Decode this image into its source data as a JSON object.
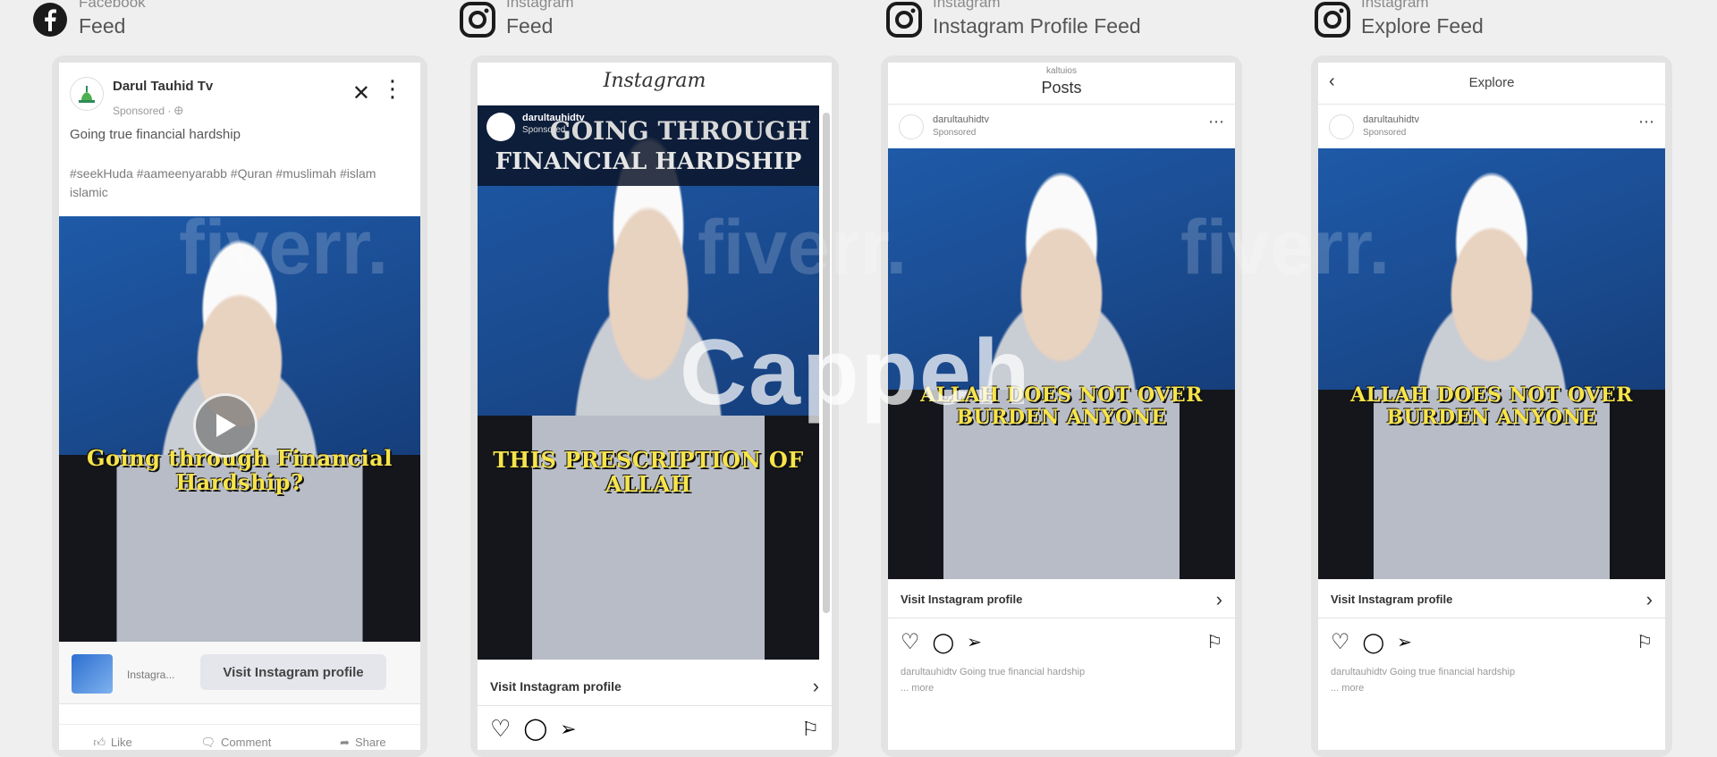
{
  "columns": [
    {
      "platform": "Facebook",
      "placement": "Feed"
    },
    {
      "platform": "Instagram",
      "placement": "Feed"
    },
    {
      "platform": "Instagram",
      "placement": "Instagram Profile Feed"
    },
    {
      "platform": "Instagram",
      "placement": "Explore Feed"
    }
  ],
  "fb": {
    "page_name": "Darul Tauhid Tv",
    "sponsored": "Sponsored · ",
    "body": "Going true financial hardship",
    "hashtags": "#seekHuda #aameenyarabb #Quran #muslimah #islam islamic",
    "caption": "Going through Financial Hardship?",
    "cta_small": "Instagra...",
    "cta_button": "Visit Instagram profile",
    "like": "Like",
    "comment": "Comment",
    "share": "Share"
  },
  "ig_feed": {
    "logo": "Instagram",
    "handle": "darultauhidtv",
    "sponsored": "Sponsored",
    "title_line1": "GOING THROUGH",
    "title_line2": "FINANCIAL HARDSHIP",
    "caption": "This prescription of Allah",
    "cta": "Visit Instagram profile"
  },
  "ig_profile": {
    "username_top": "kaltuios",
    "header": "Posts",
    "handle": "darultauhidtv",
    "sponsored": "Sponsored",
    "caption": "ALLAH DOES NOT OVER BURDEN ANYONE",
    "cta": "Visit Instagram profile",
    "post_text": "darultauhidtv Going true financial hardship",
    "more": "... more"
  },
  "ig_explore": {
    "header": "Explore",
    "handle": "darultauhidtv",
    "sponsored": "Sponsored",
    "caption": "ALLAH DOES NOT OVER BURDEN ANYONE",
    "cta": "Visit Instagram profile",
    "post_text": "darultauhidtv Going true financial hardship",
    "more": "... more"
  },
  "watermark": {
    "main": "Cappeh",
    "fiverr": "fiverr."
  },
  "colors": {
    "facebook_blue": "#1877f2",
    "caption_yellow": "#f7e44a",
    "video_blue": "#1a4a8e"
  }
}
